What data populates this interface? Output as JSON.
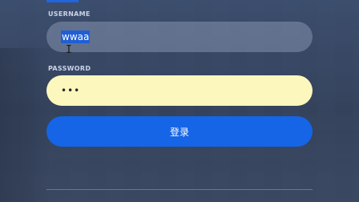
{
  "form": {
    "username_label": "USERNAME",
    "username_value": "wwaa",
    "password_label": "PASSWORD",
    "password_value": "•••",
    "login_label": "登录"
  },
  "colors": {
    "accent": "#1565e6",
    "password_bg": "#fcf7bd",
    "selection": "#1f5fd6"
  },
  "icons": {
    "cursor": "text-cursor-icon"
  }
}
